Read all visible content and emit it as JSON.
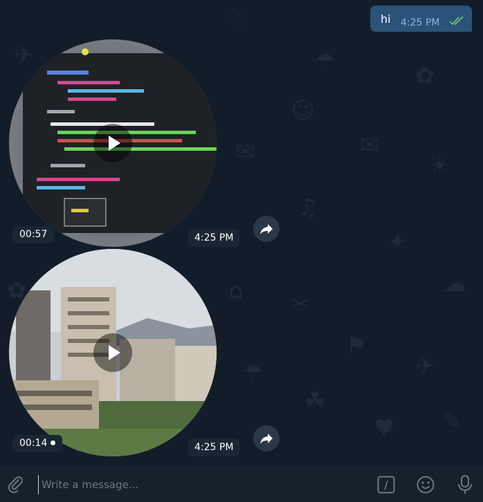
{
  "messages": {
    "outgoing_text": {
      "text": "hi",
      "time": "4:25 PM",
      "status_icon": "double-check-icon"
    },
    "video1": {
      "duration": "00:57",
      "time": "4:25 PM"
    },
    "video2": {
      "duration": "00:14",
      "time": "4:25 PM"
    }
  },
  "composer": {
    "placeholder": "Write a message...",
    "command_label": "/"
  },
  "colors": {
    "background": "#0e1621",
    "chat_background": "#131d29",
    "outgoing_bubble": "#2b5278",
    "accent_check": "#4fae4e"
  }
}
